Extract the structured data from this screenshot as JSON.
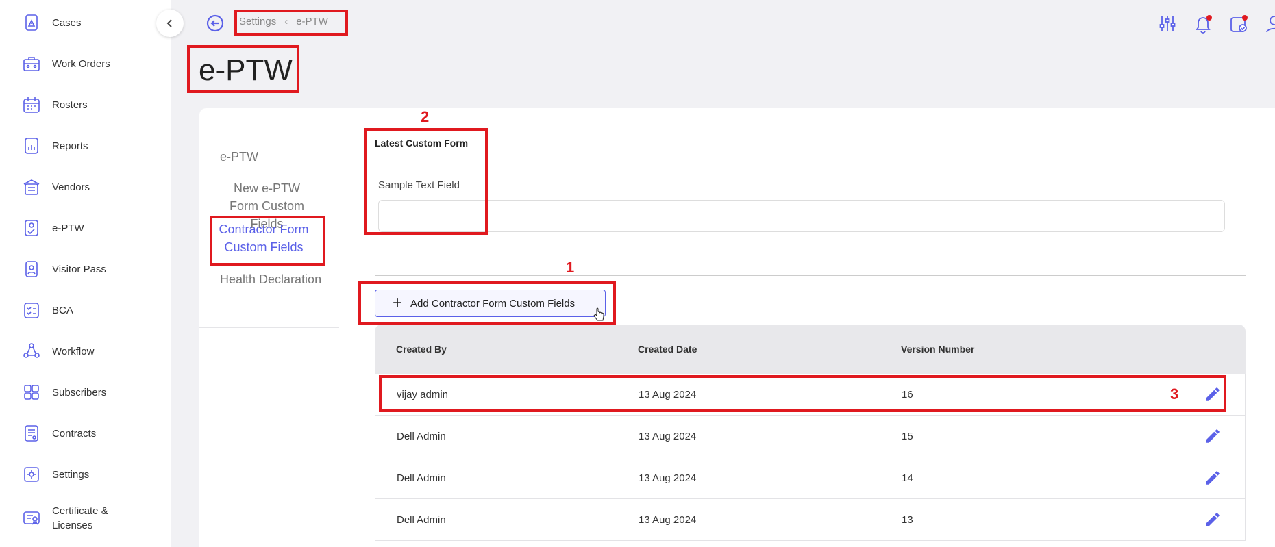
{
  "sidebar": {
    "items": [
      {
        "label": "Cases",
        "icon": "cases-icon"
      },
      {
        "label": "Work Orders",
        "icon": "work-orders-icon"
      },
      {
        "label": "Rosters",
        "icon": "calendar-icon"
      },
      {
        "label": "Reports",
        "icon": "reports-icon"
      },
      {
        "label": "Vendors",
        "icon": "vendors-icon"
      },
      {
        "label": "e-PTW",
        "icon": "eptw-icon"
      },
      {
        "label": "Visitor Pass",
        "icon": "visitor-pass-icon"
      },
      {
        "label": "BCA",
        "icon": "checklist-icon"
      },
      {
        "label": "Workflow",
        "icon": "workflow-icon"
      },
      {
        "label": "Subscribers",
        "icon": "subscribers-icon"
      },
      {
        "label": "Contracts",
        "icon": "contracts-icon"
      },
      {
        "label": "Settings",
        "icon": "settings-icon"
      },
      {
        "label": "Certificate & Licenses",
        "icon": "certificate-icon"
      }
    ]
  },
  "breadcrumb": {
    "parent": "Settings",
    "current": "e-PTW"
  },
  "page_title": "e-PTW",
  "subnav": {
    "items": [
      "e-PTW",
      "New e-PTW Form Custom Fields",
      "Contractor Form Custom Fields",
      "Health Declaration"
    ],
    "active_index": 2
  },
  "latest_form": {
    "title": "Latest Custom Form",
    "field_label": "Sample Text Field",
    "field_value": ""
  },
  "add_button_label": "Add Contractor Form Custom Fields",
  "table": {
    "headers": [
      "Created By",
      "Created Date",
      "Version Number"
    ],
    "rows": [
      {
        "created_by": "vijay admin",
        "created_date": "13 Aug 2024",
        "version": "16"
      },
      {
        "created_by": "Dell Admin",
        "created_date": "13 Aug 2024",
        "version": "15"
      },
      {
        "created_by": "Dell Admin",
        "created_date": "13 Aug 2024",
        "version": "14"
      },
      {
        "created_by": "Dell Admin",
        "created_date": "13 Aug 2024",
        "version": "13"
      }
    ]
  },
  "annotations": [
    "1",
    "2",
    "3"
  ],
  "colors": {
    "accent": "#5b61e8",
    "highlight": "#e0191f",
    "background": "#f1f1f4"
  }
}
